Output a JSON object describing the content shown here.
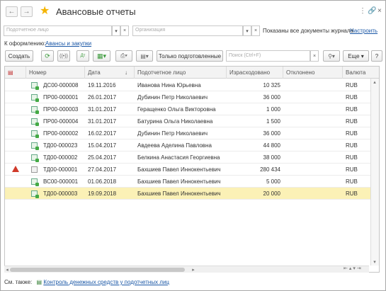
{
  "window": {
    "title": "Авансовые отчеты"
  },
  "filters": {
    "person_placeholder": "Подотчетное лицо",
    "org_placeholder": "Организация",
    "status_text": "Показаны все документы журнала",
    "settings_link": "Настроить"
  },
  "to_process": {
    "label": "К оформлению:",
    "link": "Авансы и закупки"
  },
  "toolbar": {
    "create": "Создать",
    "only_prepared": "Только подготовленные",
    "search_placeholder": "Поиск (Ctrl+F)",
    "more": "Еще",
    "help": "?"
  },
  "table": {
    "columns": [
      "Номер",
      "Дата",
      "Подотчетное лицо",
      "Израсходовано",
      "Отклонено",
      "Валюта"
    ],
    "rows": [
      {
        "number": "ДС00-000008",
        "date": "19.11.2016",
        "person": "Иванова Нина Юрьевна",
        "spent": "10 325",
        "rejected": "",
        "currency": "RUB",
        "icon": "doc-posted-icon",
        "warning": false,
        "selected": false
      },
      {
        "number": "ПР00-000001",
        "date": "26.01.2017",
        "person": "Дубинин Петр Николаевич",
        "spent": "36 000",
        "rejected": "",
        "currency": "RUB",
        "icon": "doc-posted-icon",
        "warning": false,
        "selected": false
      },
      {
        "number": "ПР00-000003",
        "date": "31.01.2017",
        "person": "Геращенко Ольга Викторовна",
        "spent": "1 000",
        "rejected": "",
        "currency": "RUB",
        "icon": "doc-posted-icon",
        "warning": false,
        "selected": false
      },
      {
        "number": "ПР00-000004",
        "date": "31.01.2017",
        "person": "Батурина Ольга Николаевна",
        "spent": "1 500",
        "rejected": "",
        "currency": "RUB",
        "icon": "doc-posted-icon",
        "warning": false,
        "selected": false
      },
      {
        "number": "ПР00-000002",
        "date": "16.02.2017",
        "person": "Дубинин Петр Николаевич",
        "spent": "36 000",
        "rejected": "",
        "currency": "RUB",
        "icon": "doc-posted-icon",
        "warning": false,
        "selected": false
      },
      {
        "number": "ТД00-000023",
        "date": "15.04.2017",
        "person": "Авдеева Аделина Павловна",
        "spent": "44 800",
        "rejected": "",
        "currency": "RUB",
        "icon": "doc-posted-icon",
        "warning": false,
        "selected": false
      },
      {
        "number": "ТД00-000002",
        "date": "25.04.2017",
        "person": "Белкина Анастасия Георгиевна",
        "spent": "38 000",
        "rejected": "",
        "currency": "RUB",
        "icon": "doc-posted-icon",
        "warning": false,
        "selected": false
      },
      {
        "number": "ТД00-000001",
        "date": "27.04.2017",
        "person": "Бахшиев Павел Иннокентьевич",
        "spent": "280 434",
        "rejected": "",
        "currency": "RUB",
        "icon": "doc-draft-icon",
        "warning": true,
        "selected": false
      },
      {
        "number": "ВС00-000001",
        "date": "01.06.2018",
        "person": "Бахшиев Павел Иннокентьевич",
        "spent": "5 000",
        "rejected": "",
        "currency": "RUB",
        "icon": "doc-posted-icon",
        "warning": false,
        "selected": false
      },
      {
        "number": "ТД00-000003",
        "date": "19.09.2018",
        "person": "Бахшиев Павел Иннокентьевич",
        "spent": "20 000",
        "rejected": "",
        "currency": "RUB",
        "icon": "doc-posted-icon",
        "warning": false,
        "selected": true
      }
    ]
  },
  "footer": {
    "label": "См. также:",
    "link": "Контроль денежных средств у подотчетных лиц"
  }
}
